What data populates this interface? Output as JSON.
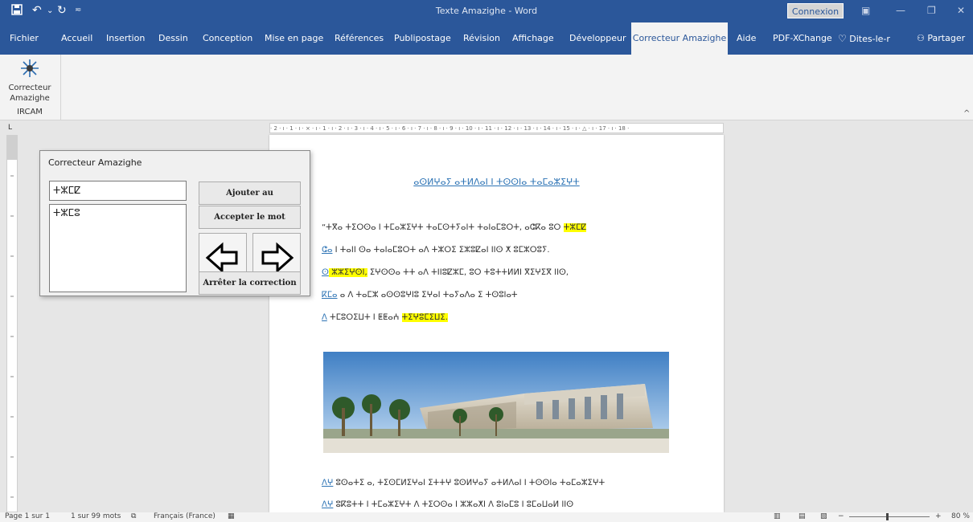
{
  "window": {
    "title": "Texte Amazighe - Word",
    "connexion_label": "Connexion"
  },
  "tabs": [
    "Fichier",
    "Accueil",
    "Insertion",
    "Dessin",
    "Conception",
    "Mise en page",
    "Références",
    "Publipostage",
    "Révision",
    "Affichage",
    "Développeur",
    "Correcteur Amazighe",
    "Aide",
    "PDF-XChange",
    "Dites-le-r",
    "Partager"
  ],
  "ribbon": {
    "button_line1": "Correcteur",
    "button_line2": "Amazighe",
    "group_label": "IRCAM"
  },
  "ruler": {
    "horizontal": "· 2 · ı · 1 · ı · ⨯ · ı · 1 · ı · 2 · ı · 3 · ı · 4 · ı · 5 · ı · 6 · ı · 7 · ı · 8 · ı · 9 · ı · 10 · ı · 11 · ı · 12 · ı · 13 · ı · 14 · ı · 15 · ı · △ · ı · 17 · ı · 18 ·"
  },
  "document": {
    "title": "ⴰⵙⵍⵖⴰⵢ ⴰⵜⵍⴷⴰⵏ ⵏ ⵜⵙⵙⵏⴰ ⵜⴰⵎⴰⵣⵉⵖⵜ",
    "lines": [
      {
        "prefix": "“ⵜⴳⴰ ⵜⵉⵔⵙⴰ ⵏ ⵜⵎⴰⵣⵉⵖⵜ ⵜⴰⵎⵙⵜⵢⴰⵏⵜ ⵜⴰⵏⴰⵎⵓⵔⵜ, ⴰⵛⴽⴰ ⵓⵔ ",
        "highlight": "ⵜⵣⵎⵇ",
        "suffix": ""
      },
      {
        "prefix": "",
        "link": "ⵛⴰ",
        "suffix": " ⵏ ⵜⴰⵏⵏ ⵙⴰ ⵜⴰⵏⴰⵎⵓⵔⵜ ⴰⴷ ⵜⵣⵔⵉ ⵉⵣⵓⵇⴰⵏ ⵏⵏⵙ ⵅ ⵓⵎⵣⵔⵓⵢ."
      },
      {
        "prefix": "",
        "link": "ⵙ",
        "highlight": " ⵣⵣⵉⵖⵙⵏ,",
        "suffix": " ⵉⵖⵙⵙⴰ ⵜⵜ ⴰⴷ ⵜⵏⵏⵓⵇⵣⵎ, ⵓⵔ ⵜⵓⵜⵜⵍⵍⵏ ⴳⵉⵖⵉⴳ ⵏⵏⵙ,"
      },
      {
        "prefix": " ",
        "link": "ⴽⵎⴰ",
        "suffix": " ⴰ ⴷ ⵜⴰⵎⵣ ⴰⵙⵙⵓⵖⵏⵓ ⵉⵖⴰⵏ ⵜⴰⵢⴰⴷⴰ ⵉ ⵜⵙⵓⵏⴰⵜ"
      },
      {
        "prefix": "",
        "link": "ⴷ",
        "suffix": " ⵜⵎⵓⵔⵉⵡⵜ ⵏ ⵟⵟⴰⵄ ",
        "highlight": "ⵜⵉⵖⵓⵎⵉⵡⵉ."
      }
    ],
    "footer_lines": [
      {
        "link": "ⴷⵖ",
        "text": " ⵓⵙⴰⵜⵉ ⴰ, ⵜⵉⵙⵎⵍⵉⵖⴰⵏ ⵉⵜⵜⵖ ⵓⵙⵍⵖⴰⵢ ⴰⵜⵍⴷⴰⵏ ⵏ ⵜⵙⵙⵏⴰ ⵜⴰⵎⴰⵣⵉⵖⵜ"
      },
      {
        "link": "ⴷⵖ",
        "text": " ⵓⴽⵓⵜⵜ ⵏ ⵜⵎⴰⵣⵉⵖⵜ ⴷ ⵜⵉⵔⵙⴰ ⵏ ⵣⵣⴰⵅⵏ ⴷ ⵓⵏⴰⵎⵓ ⵏ ⵓⵎⴰⵡⴰⵍ ⵏⵏⵙ"
      }
    ]
  },
  "status": {
    "page": "Page 1 sur 1",
    "words": "1 sur 99 mots",
    "language": "Français (France)",
    "zoom": "80 %"
  },
  "dialog": {
    "title": "Correcteur Amazighe",
    "input_value": "ⵜⵣⵎⵇ",
    "suggestions": [
      "ⵜⵣⵎⵓ"
    ],
    "add_label": "Ajouter au dictionnaire",
    "accept_label": "Accepter le mot",
    "stop_label": "Arrêter la correction"
  }
}
